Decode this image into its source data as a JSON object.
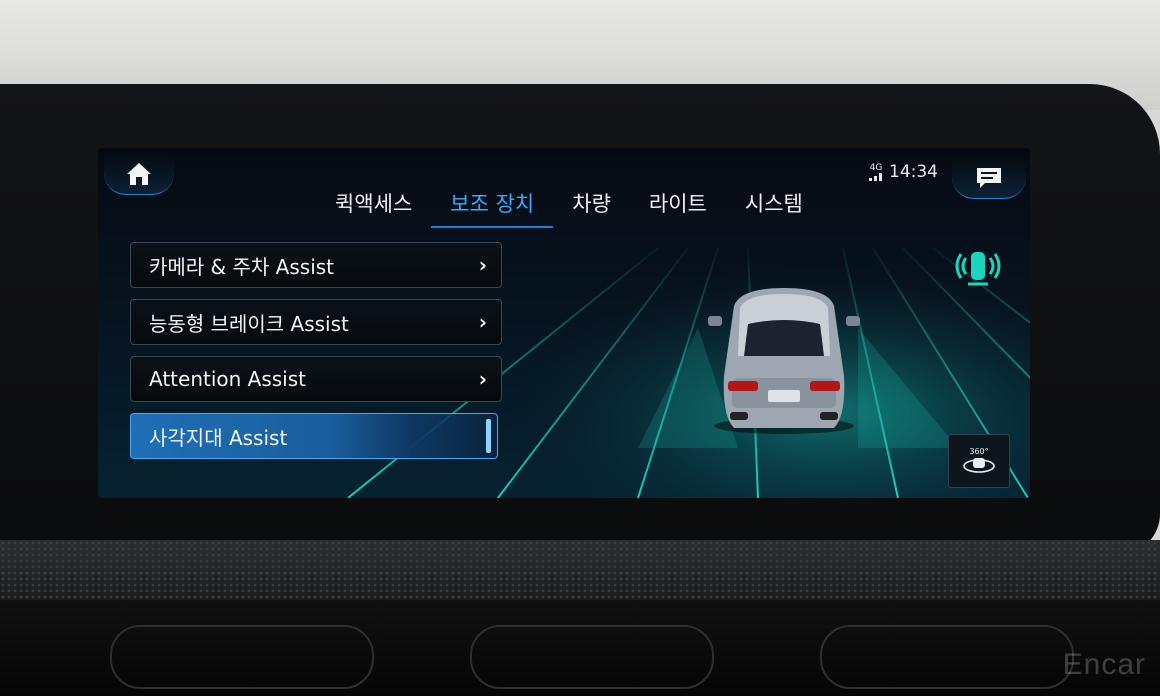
{
  "status": {
    "network": "4G",
    "time": "14:34"
  },
  "tabs": [
    {
      "label": "퀵액세스"
    },
    {
      "label": "보조 장치",
      "active": true
    },
    {
      "label": "차량"
    },
    {
      "label": "라이트"
    },
    {
      "label": "시스템"
    }
  ],
  "menu": [
    {
      "label": "카메라 & 주차 Assist",
      "chevron": "›"
    },
    {
      "label": "능동형 브레이크 Assist",
      "chevron": "›"
    },
    {
      "label": "Attention Assist",
      "chevron": "›"
    },
    {
      "label": "사각지대 Assist",
      "selected": true
    }
  ],
  "view360": {
    "label": "360°"
  },
  "watermark": "Encar",
  "icons": {
    "home": "home-icon",
    "messages": "message-icon",
    "sensors": "car-sensor-icon",
    "view360": "360-view-icon"
  },
  "colors": {
    "accent": "#38a9ff",
    "selected": "#1f6fb6",
    "grid": "#1fe0c8"
  }
}
